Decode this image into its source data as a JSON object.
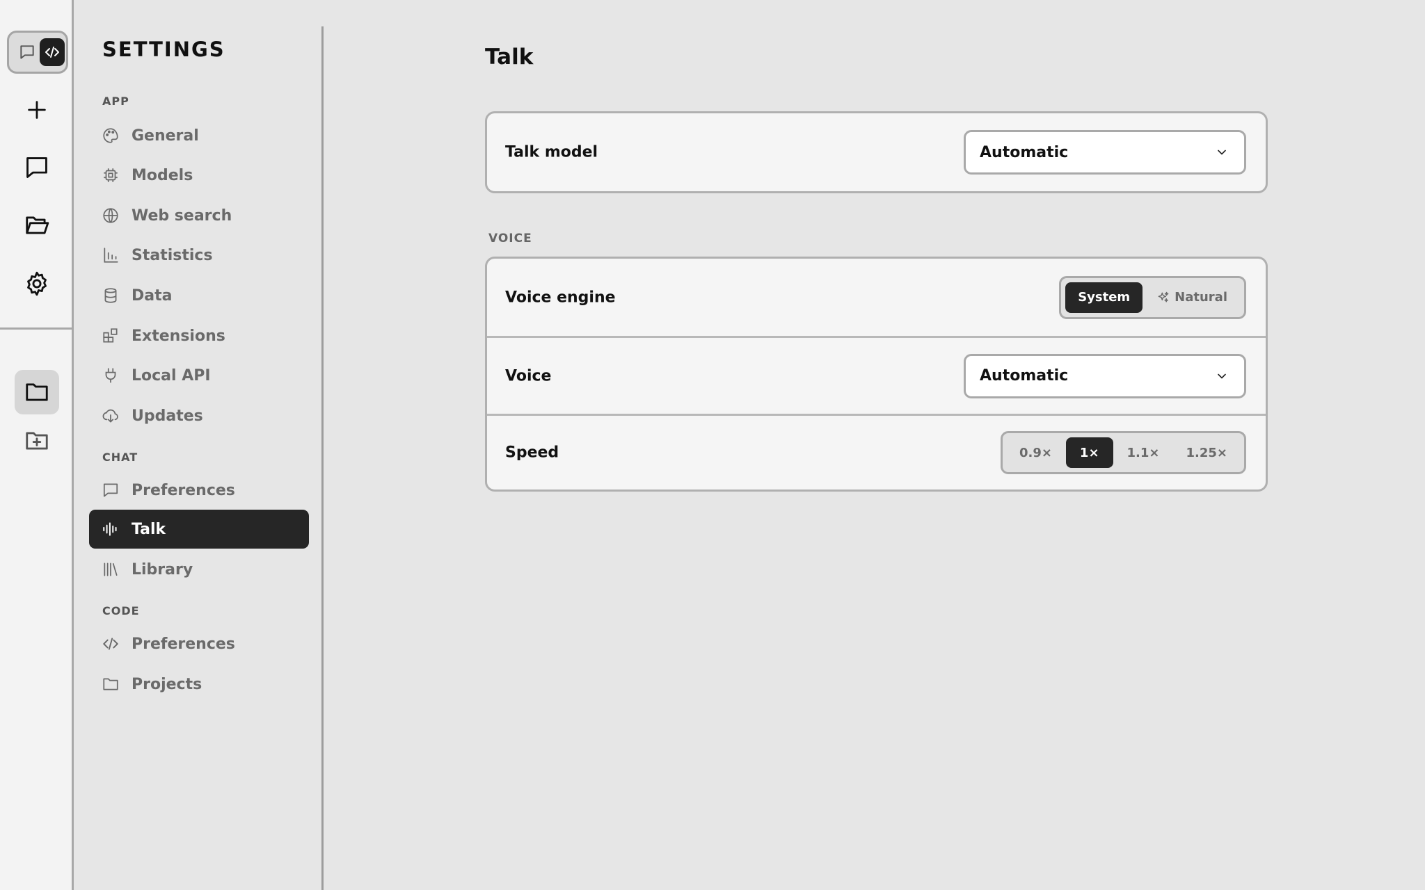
{
  "sidebar": {
    "title": "SETTINGS",
    "sections": {
      "app": "APP",
      "chat": "CHAT",
      "code": "CODE"
    },
    "items": {
      "general": "General",
      "models": "Models",
      "web_search": "Web search",
      "statistics": "Statistics",
      "data": "Data",
      "extensions": "Extensions",
      "local_api": "Local API",
      "updates": "Updates",
      "chat_preferences": "Preferences",
      "talk": "Talk",
      "library": "Library",
      "code_preferences": "Preferences",
      "projects": "Projects"
    },
    "active_item": "Talk"
  },
  "rail": {
    "icons": [
      "chat-mode-icon",
      "code-mode-icon",
      "plus-icon",
      "chat-bubble-icon",
      "folder-open-icon",
      "gear-icon",
      "folder-icon",
      "folder-plus-icon"
    ]
  },
  "main": {
    "title": "Talk",
    "talk_model": {
      "label": "Talk model",
      "value": "Automatic"
    },
    "voice_section_label": "VOICE",
    "voice_engine": {
      "label": "Voice engine",
      "options": [
        "System",
        "Natural"
      ],
      "selected": "System"
    },
    "voice": {
      "label": "Voice",
      "value": "Automatic"
    },
    "speed": {
      "label": "Speed",
      "options": [
        "0.9×",
        "1×",
        "1.1×",
        "1.25×"
      ],
      "selected": "1×"
    }
  },
  "colors": {
    "background": "#e6e6e6",
    "active": "#262626",
    "card": "#f5f5f5"
  }
}
